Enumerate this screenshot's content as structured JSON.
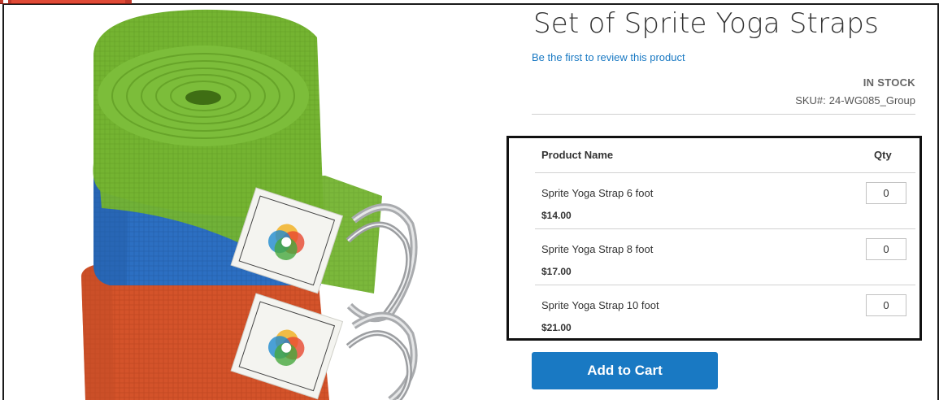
{
  "product": {
    "title": "Set of Sprite Yoga Straps",
    "review_link": "Be the first to review this product",
    "stock": "IN STOCK",
    "sku_label": "SKU#:",
    "sku_value": "24-WG085_Group"
  },
  "grouped": {
    "col_name": "Product Name",
    "col_qty": "Qty",
    "items": [
      {
        "name": "Sprite Yoga Strap 6 foot",
        "price": "$14.00",
        "qty": "0"
      },
      {
        "name": "Sprite Yoga Strap 8 foot",
        "price": "$17.00",
        "qty": "0"
      },
      {
        "name": "Sprite Yoga Strap 10 foot",
        "price": "$21.00",
        "qty": "0"
      }
    ]
  },
  "actions": {
    "add_to_cart": "Add to Cart"
  },
  "colors": {
    "accent": "#1979c3",
    "strap_green": "#7ab83a",
    "strap_blue": "#2f74c6",
    "strap_orange": "#d8572a"
  }
}
